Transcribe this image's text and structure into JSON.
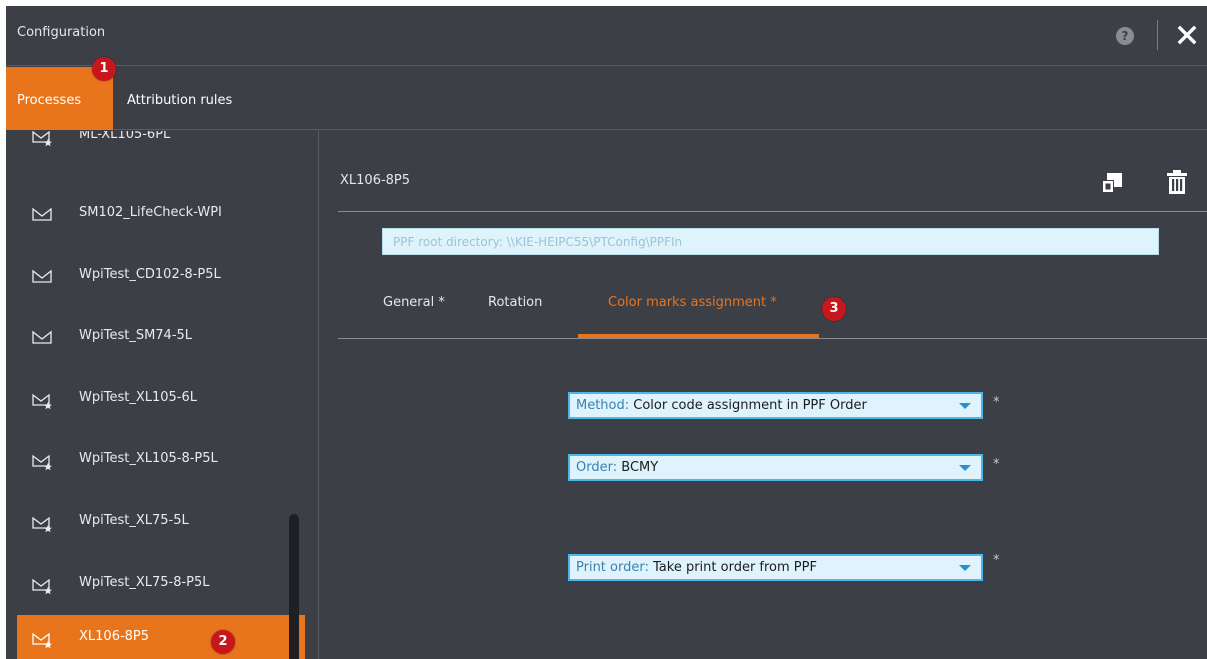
{
  "window": {
    "title": "Configuration",
    "help_label": "?"
  },
  "tabs": {
    "processes": "Processes",
    "attribution_rules": "Attribution rules"
  },
  "badges": {
    "one": "1",
    "two": "2",
    "three": "3"
  },
  "sidebar": {
    "items": [
      {
        "label": "ML-XL105-6PL",
        "icon": "multi-process-icon"
      },
      {
        "label": "SM102_LifeCheck-WPI",
        "icon": "process-icon"
      },
      {
        "label": "WpiTest_CD102-8-P5L",
        "icon": "process-icon"
      },
      {
        "label": "WpiTest_SM74-5L",
        "icon": "process-icon"
      },
      {
        "label": "WpiTest_XL105-6L",
        "icon": "multi-process-icon"
      },
      {
        "label": "WpiTest_XL105-8-P5L",
        "icon": "multi-process-icon"
      },
      {
        "label": "WpiTest_XL75-5L",
        "icon": "multi-process-icon"
      },
      {
        "label": "WpiTest_XL75-8-P5L",
        "icon": "multi-process-icon"
      },
      {
        "label": "XL106-8P5",
        "icon": "multi-process-icon",
        "active": true
      }
    ]
  },
  "main": {
    "process_name": "XL106-8P5",
    "ppf_root_label": "PPF root directory:",
    "ppf_root_value": "\\\\KIE-HEIPC55\\PTConfig\\PPFIn",
    "subtabs": {
      "general": "General  *",
      "rotation": "Rotation",
      "color_marks": "Color marks assignment  *"
    },
    "fields": {
      "method_key": "Method:",
      "method_value": "Color code assignment in PPF Order",
      "order_key": "Order:",
      "order_value": "BCMY",
      "print_order_key": "Print order:",
      "print_order_value": "Take print order from PPF",
      "required_marker": "*"
    }
  },
  "colors": {
    "background": "#3d3f47",
    "accent": "#e8741c",
    "badge": "#c8161d",
    "field_bg": "#def3fb",
    "field_border": "#4db8e8"
  }
}
